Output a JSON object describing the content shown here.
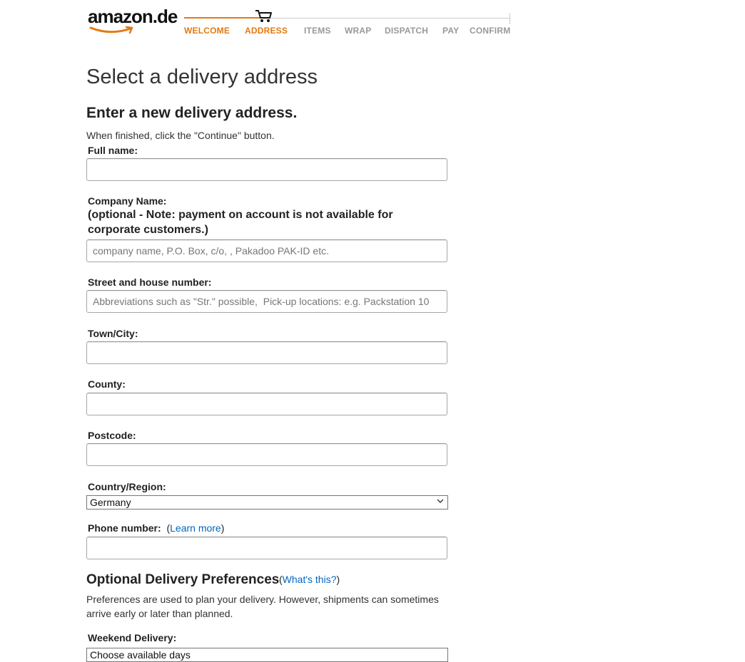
{
  "header": {
    "logo_text": "amazon.de",
    "steps": [
      "WELCOME",
      "ADDRESS",
      "ITEMS",
      "WRAP",
      "DISPATCH",
      "PAY",
      "CONFIRM"
    ],
    "current_step": "ADDRESS",
    "accent_color": "#e47911",
    "inactive_color": "#999999"
  },
  "page": {
    "title": "Select a delivery address",
    "section_title": "Enter a new delivery address.",
    "hint": "When finished, click the \"Continue\" button."
  },
  "form": {
    "full_name": {
      "label": "Full name:",
      "value": "",
      "placeholder": ""
    },
    "company": {
      "label": "Company Name:",
      "note": "(optional - Note: payment on account is not available for corporate customers.)",
      "value": "",
      "placeholder": "company name, P.O. Box, c/o, , Pakadoo PAK-ID etc."
    },
    "street": {
      "label": "Street and house number:",
      "value": "",
      "placeholder": "Abbreviations such as \"Str.\" possible,  Pick-up locations: e.g. Packstation 10"
    },
    "town": {
      "label": "Town/City:",
      "value": "",
      "placeholder": ""
    },
    "county": {
      "label": "County:",
      "value": "",
      "placeholder": ""
    },
    "postcode": {
      "label": "Postcode:",
      "value": "",
      "placeholder": ""
    },
    "country": {
      "label": "Country/Region:",
      "selected": "Germany"
    },
    "phone": {
      "label": "Phone number:",
      "link": "Learn more",
      "value": "",
      "placeholder": ""
    }
  },
  "delivery_prefs": {
    "title": "Optional Delivery Preferences",
    "help_link": "What's this?",
    "description": "Preferences are used to plan your delivery. However, shipments can sometimes arrive early or later than planned.",
    "weekend_label": "Weekend Delivery:",
    "weekend_selected": "Choose available days"
  },
  "link_color": "#0066c0"
}
